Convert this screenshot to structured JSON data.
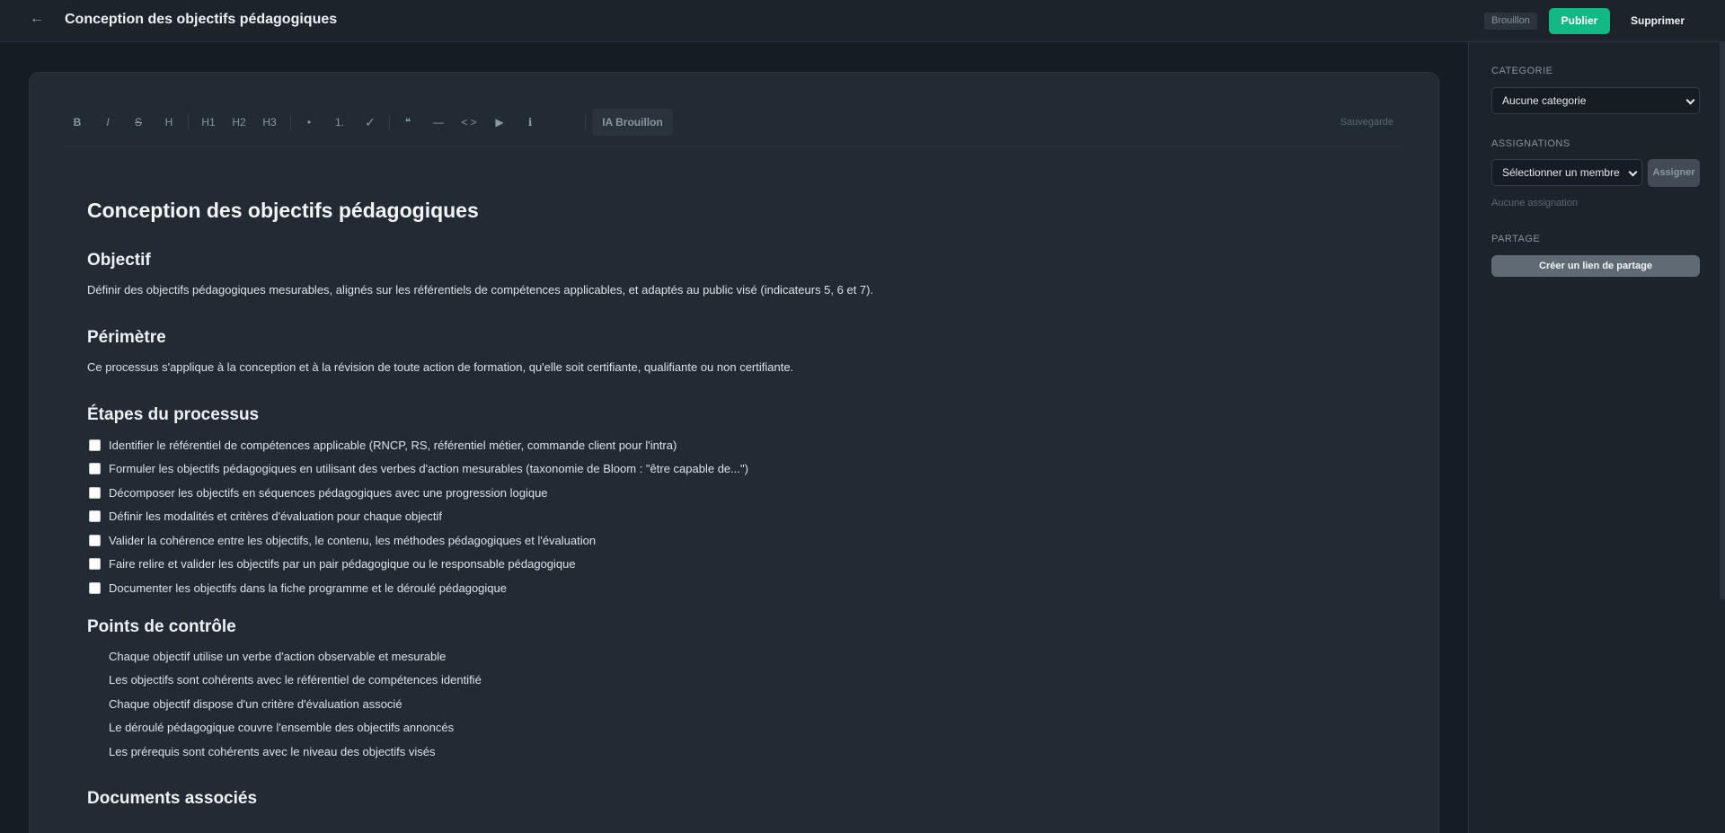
{
  "header": {
    "back_icon": "←",
    "title": "Conception des objectifs pédagogiques",
    "status_badge": "Brouillon",
    "publish_label": "Publier",
    "delete_label": "Supprimer"
  },
  "toolbar": {
    "buttons": [
      "B",
      "I",
      "S",
      "H",
      "H1",
      "H2",
      "H3",
      "•",
      "1.",
      "✓",
      "❝",
      "—",
      "< >",
      "▶",
      "ℹ"
    ],
    "ai_label": "IA Brouillon",
    "saved_label": "Sauvegarde"
  },
  "document": {
    "title": "Conception des objectifs pédagogiques",
    "sections": {
      "objectif": {
        "heading": "Objectif",
        "text": "Définir des objectifs pédagogiques mesurables, alignés sur les référentiels de compétences applicables, et adaptés au public visé (indicateurs 5, 6 et 7)."
      },
      "perimetre": {
        "heading": "Périmètre",
        "text": "Ce processus s'applique à la conception et à la révision de toute action de formation, qu'elle soit certifiante, qualifiante ou non certifiante."
      },
      "etapes": {
        "heading": "Étapes du processus",
        "items": [
          "Identifier le référentiel de compétences applicable (RNCP, RS, référentiel métier, commande client pour l'intra)",
          "Formuler les objectifs pédagogiques en utilisant des verbes d'action mesurables (taxonomie de Bloom : \"être capable de...\")",
          "Décomposer les objectifs en séquences pédagogiques avec une progression logique",
          "Définir les modalités et critères d'évaluation pour chaque objectif",
          "Valider la cohérence entre les objectifs, le contenu, les méthodes pédagogiques et l'évaluation",
          "Faire relire et valider les objectifs par un pair pédagogique ou le responsable pédagogique",
          "Documenter les objectifs dans la fiche programme et le déroulé pédagogique"
        ]
      },
      "controle": {
        "heading": "Points de contrôle",
        "items": [
          "Chaque objectif utilise un verbe d'action observable et mesurable",
          "Les objectifs sont cohérents avec le référentiel de compétences identifié",
          "Chaque objectif dispose d'un critère d'évaluation associé",
          "Le déroulé pédagogique couvre l'ensemble des objectifs annoncés",
          "Les prérequis sont cohérents avec le niveau des objectifs visés"
        ]
      },
      "documents": {
        "heading": "Documents associés"
      }
    }
  },
  "sidebar": {
    "category_label": "CATEGORIE",
    "category_value": "Aucune categorie",
    "assign_label": "ASSIGNATIONS",
    "member_placeholder": "Sélectionner un membre",
    "assign_button": "Assigner",
    "no_assignment": "Aucune assignation",
    "share_label": "PARTAGE",
    "share_button": "Créer un lien de partage"
  },
  "colors": {
    "accent": "#14b884",
    "background": "#161c23",
    "card": "#222a33"
  }
}
